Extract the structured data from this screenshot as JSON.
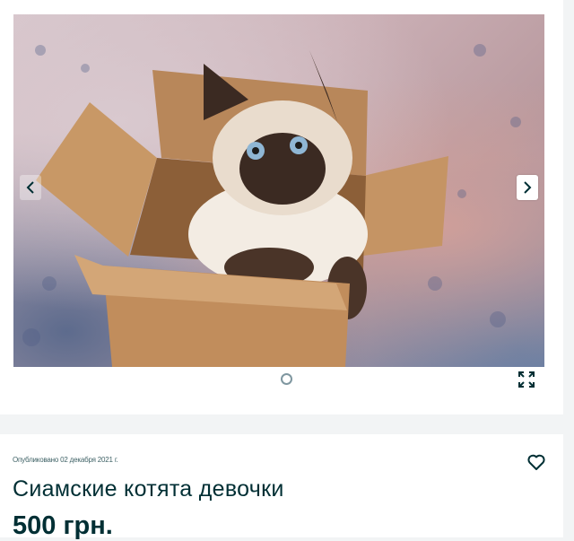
{
  "listing": {
    "published": "Опубликовано 02 декабря 2021 г.",
    "title": "Сиамские котята девочки",
    "price": "500 грн."
  },
  "gallery": {
    "prev_icon": "chevron-left-icon",
    "next_icon": "chevron-right-icon",
    "fullscreen_icon": "expand-icon",
    "image_subject": "siamese-kitten-in-box-photo"
  },
  "actions": {
    "favorite_icon": "heart-icon"
  },
  "colors": {
    "text_primary": "#002f34",
    "text_secondary": "#406367",
    "page_bg": "#f2f4f5"
  }
}
